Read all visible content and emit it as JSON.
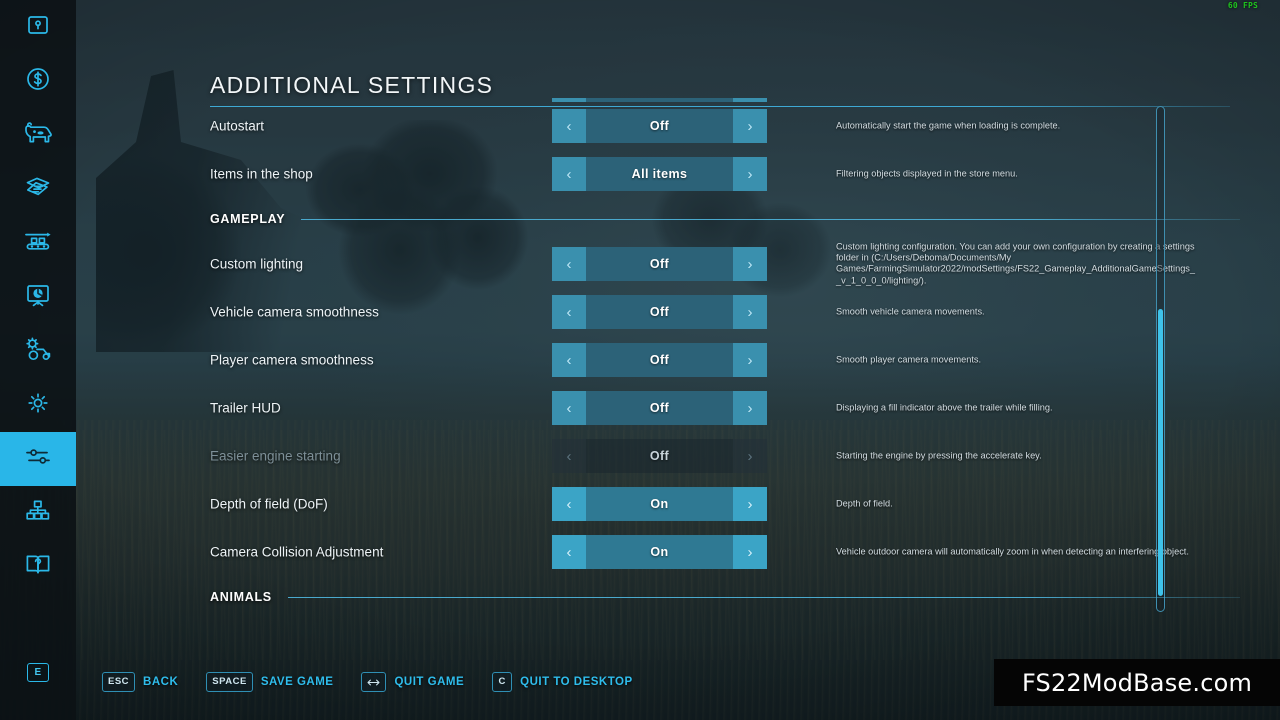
{
  "window": {
    "fps": "60 FPS",
    "watermark": "FS22ModBase.com"
  },
  "sidebar": {
    "items": [
      {
        "name": "map-overview",
        "icon": "map-marker-icon"
      },
      {
        "name": "finances",
        "icon": "dollar-coin-icon"
      },
      {
        "name": "animals",
        "icon": "cow-icon"
      },
      {
        "name": "contracts",
        "icon": "documents-icon"
      },
      {
        "name": "production",
        "icon": "production-chain-icon"
      },
      {
        "name": "statistics",
        "icon": "statistics-board-icon"
      },
      {
        "name": "vehicle-settings",
        "icon": "gear-tractor-icon"
      },
      {
        "name": "game-settings",
        "icon": "gear-icon"
      },
      {
        "name": "general-settings",
        "icon": "sliders-icon"
      },
      {
        "name": "mod-hub",
        "icon": "blocks-icon"
      },
      {
        "name": "help",
        "icon": "help-book-icon"
      }
    ],
    "active_index": 8,
    "bottom_key": "E"
  },
  "header": {
    "title": "ADDITIONAL SETTINGS"
  },
  "settings": {
    "rows": [
      {
        "type": "partial",
        "name": "clipped-row-above",
        "label": "",
        "value": "",
        "description": "",
        "state": "normal"
      },
      {
        "type": "option",
        "name": "autostart",
        "label": "Autostart",
        "value": "Off",
        "description": "Automatically start the game when loading is complete.",
        "state": "normal"
      },
      {
        "type": "option",
        "name": "items-in-the-shop",
        "label": "Items in the shop",
        "value": "All items",
        "description": "Filtering objects displayed in the store menu.",
        "state": "normal"
      },
      {
        "type": "section",
        "name": "section-gameplay",
        "label": "GAMEPLAY"
      },
      {
        "type": "option",
        "name": "custom-lighting",
        "label": "Custom lighting",
        "value": "Off",
        "description": "Custom lighting configuration. You can add your own configuration by creating a settings folder in (C:/Users/Deboma/Documents/My Games/FarmingSimulator2022/modSettings/FS22_Gameplay_AdditionalGameSettings__v_1_0_0_0/lighting/).",
        "state": "normal"
      },
      {
        "type": "option",
        "name": "vehicle-camera-smoothness",
        "label": "Vehicle camera smoothness",
        "value": "Off",
        "description": "Smooth vehicle camera movements.",
        "state": "normal"
      },
      {
        "type": "option",
        "name": "player-camera-smoothness",
        "label": "Player camera smoothness",
        "value": "Off",
        "description": "Smooth player camera movements.",
        "state": "normal"
      },
      {
        "type": "option",
        "name": "trailer-hud",
        "label": "Trailer HUD",
        "value": "Off",
        "description": "Displaying a fill indicator above the trailer while filling.",
        "state": "normal"
      },
      {
        "type": "option",
        "name": "easier-engine-starting",
        "label": "Easier engine starting",
        "value": "Off",
        "description": "Starting the engine by pressing the accelerate key.",
        "state": "disabled"
      },
      {
        "type": "option",
        "name": "depth-of-field",
        "label": "Depth of field (DoF)",
        "value": "On",
        "description": "Depth of field.",
        "state": "bright"
      },
      {
        "type": "option",
        "name": "camera-collision-adjustment",
        "label": "Camera Collision Adjustment",
        "value": "On",
        "description": "Vehicle outdoor camera will automatically zoom in when detecting an interfering object.",
        "state": "bright"
      },
      {
        "type": "section",
        "name": "section-animals",
        "label": "ANIMALS"
      }
    ],
    "arrow_left": "‹",
    "arrow_right": "›"
  },
  "helpbar": {
    "items": [
      {
        "key": "ESC",
        "label": "BACK",
        "icon": ""
      },
      {
        "key": "SPACE",
        "label": "SAVE GAME",
        "icon": ""
      },
      {
        "key": "",
        "label": "QUIT GAME",
        "icon": "left-right-arrow-icon"
      },
      {
        "key": "C",
        "label": "QUIT TO DESKTOP",
        "icon": ""
      }
    ]
  },
  "colors": {
    "accent": "#2bb8e8",
    "accent_bright": "#3fc3ea",
    "option_arrow": "#3a90ae",
    "option_center": "#2c6278",
    "fps_green": "#1fc41f"
  }
}
